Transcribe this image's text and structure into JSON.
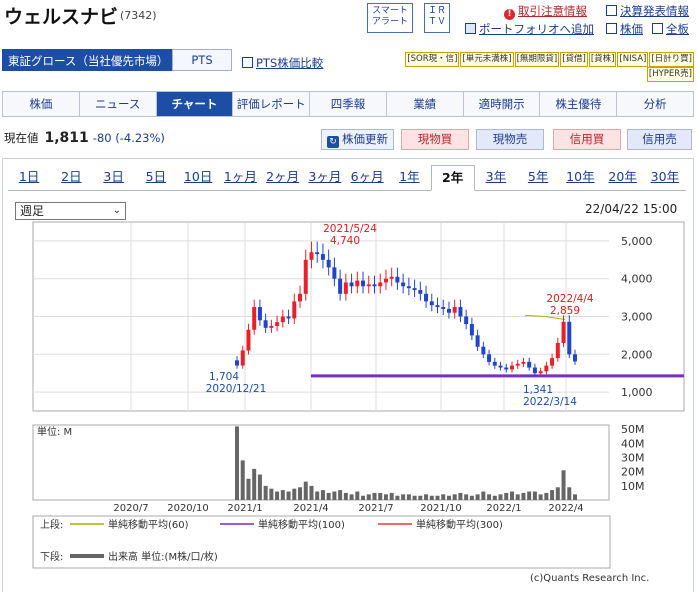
{
  "header": {
    "company_name": "ウェルスナビ",
    "code": "(7342)",
    "alert_button": "スマート\nアラート",
    "irtv_button": "ＩＲ\nＴＶ",
    "links": {
      "delisting": "取引注意情報",
      "earnings": "決算発表情報",
      "portfolio": "ポートフォリオへ追加",
      "stock_price": "株価",
      "full_board": "全板"
    }
  },
  "market": {
    "label": "東証グロース（当社優先市場）",
    "pts_button": "PTS",
    "pts_compare": "PTS株価比較"
  },
  "badges": [
    "[SOR現・信]",
    "[単元未満株]",
    "[無期限貸]",
    "[貸借]",
    "[貸株]",
    "[NISA]",
    "[日計り買]",
    "[HYPER売]"
  ],
  "tabs": [
    "株価",
    "ニュース",
    "チャート",
    "評価レポート",
    "四季報",
    "業績",
    "適時開示",
    "株主優待",
    "分析"
  ],
  "active_tab": "チャート",
  "price": {
    "label": "現在値",
    "value": "1,811",
    "change": "-80 (-4.23%)"
  },
  "actions": {
    "refresh": "株価更新",
    "genbuy": "現物買",
    "gensell": "現物売",
    "credbuy": "信用買",
    "credsell": "信用売"
  },
  "periods": [
    "1日",
    "2日",
    "3日",
    "5日",
    "10日",
    "1ヶ月",
    "2ヶ月",
    "3ヶ月",
    "6ヶ月",
    "1年",
    "2年",
    "3年",
    "5年",
    "10年",
    "20年",
    "30年"
  ],
  "active_period": "2年",
  "period_select": "週足",
  "timestamp": "22/04/22 15:00",
  "credit": "(c)Quants Research Inc.",
  "colors": {
    "up": "#e8202a",
    "down": "#2244cc",
    "ma60": "#a6b400",
    "ma100": "#7a2cc9",
    "ma300": "#e83a3a",
    "volume": "#666666"
  },
  "chart_data": {
    "type": "candlestick",
    "period": "weekly",
    "price_axis": {
      "ticks": [
        "5,000",
        "4,000",
        "3,000",
        "2,000",
        "1,000"
      ],
      "ylim": [
        500,
        5500
      ]
    },
    "volume_axis": {
      "unit_label": "単位: M",
      "ticks": [
        "50M",
        "40M",
        "30M",
        "20M",
        "10M"
      ],
      "ylim": [
        0,
        53
      ]
    },
    "x_ticks": [
      "2020/7",
      "2020/10",
      "2021/1",
      "2021/4",
      "2021/7",
      "2021/10",
      "2022/1",
      "2022/4"
    ],
    "annotations": [
      {
        "date": "2021/5/24",
        "value": "4,740",
        "kind": "high"
      },
      {
        "date": "2022/4/4",
        "value": "2,859",
        "kind": "high"
      },
      {
        "date": "2020/12/21",
        "value": "1,704",
        "kind": "low"
      },
      {
        "date": "2022/3/14",
        "value": "1,341",
        "kind": "low"
      }
    ],
    "ma100_level": 1430,
    "weekly_close": [
      1704,
      2100,
      2650,
      3250,
      2900,
      2700,
      2750,
      2850,
      3000,
      2950,
      3400,
      3600,
      4500,
      4700,
      4650,
      4500,
      4300,
      4000,
      3600,
      3900,
      3800,
      3950,
      3800,
      3850,
      3800,
      3900,
      4000,
      4050,
      3900,
      3800,
      3750,
      3700,
      3600,
      3400,
      3300,
      3250,
      3200,
      3100,
      3250,
      3000,
      2800,
      2500,
      2200,
      2000,
      1800,
      1700,
      1650,
      1600,
      1700,
      1750,
      1800,
      1650,
      1500,
      1550,
      1700,
      1900,
      2300,
      2859,
      2000,
      1811
    ],
    "weekly_volume": [
      52,
      28,
      15,
      22,
      18,
      10,
      8,
      6,
      7,
      6,
      8,
      9,
      13,
      10,
      6,
      7,
      5,
      6,
      7,
      5,
      4,
      6,
      3,
      4,
      5,
      5,
      4,
      5,
      3,
      4,
      4,
      3,
      3,
      4,
      3,
      3,
      4,
      3,
      4,
      5,
      4,
      3,
      4,
      6,
      4,
      3,
      4,
      5,
      6,
      4,
      5,
      6,
      6,
      4,
      5,
      7,
      9,
      21,
      9,
      4
    ],
    "legend": {
      "upper_label": "上段:",
      "lower_label": "下段:",
      "ma60": "単純移動平均(60)",
      "ma100": "単純移動平均(100)",
      "ma300": "単純移動平均(300)",
      "volume": "出来高 単位:(M株/口/枚)"
    }
  }
}
